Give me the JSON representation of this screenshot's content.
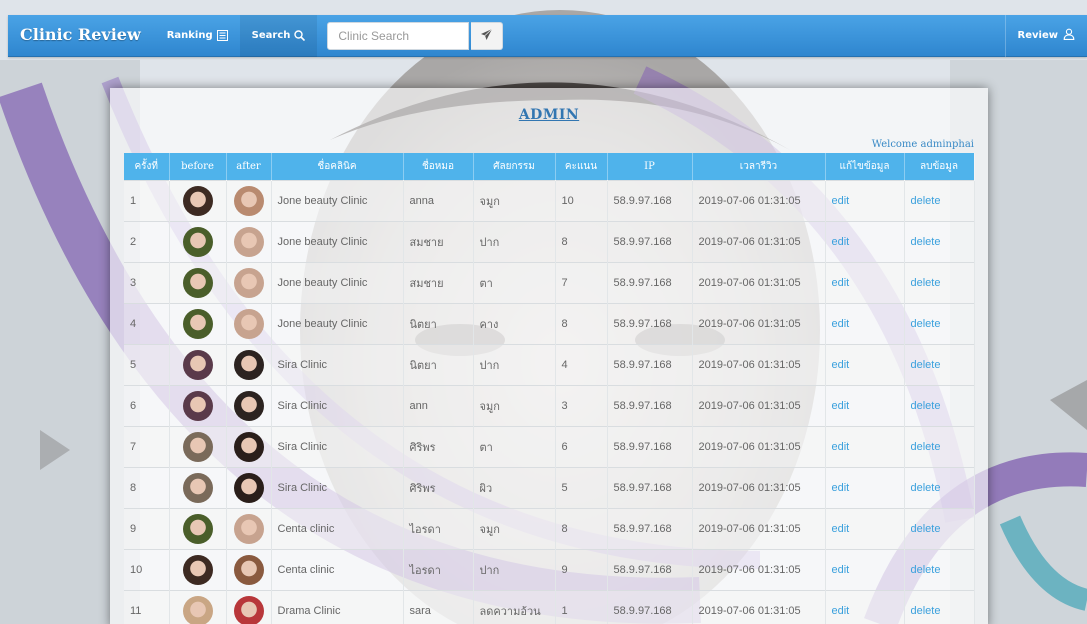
{
  "navbar": {
    "brand": "Clinic Review",
    "ranking_label": "Ranking",
    "search_label": "Search",
    "search_placeholder": "Clinic Search",
    "review_label": "Review"
  },
  "admin": {
    "title": "ADMIN",
    "welcome": "Welcome adminphai"
  },
  "table": {
    "headers": [
      "ครั้งที่",
      "before",
      "after",
      "ชื่อคลินิค",
      "ชื่อหมอ",
      "ศัลยกรรม",
      "คะแนน",
      "IP",
      "เวลารีวิว",
      "แก้ไขข้อมูล",
      "ลบข้อมูล"
    ],
    "rows": [
      {
        "no": "1",
        "clinic": "Jone beauty Clinic",
        "doctor": "anna",
        "surgery": "จมูก",
        "score": "10",
        "ip": "58.9.97.168",
        "time": "2019-07-06 01:31:05",
        "edit": "edit",
        "delete": "delete",
        "before_color": "#3d2a22",
        "after_color": "#b98a6f"
      },
      {
        "no": "2",
        "clinic": "Jone beauty Clinic",
        "doctor": "สมชาย",
        "surgery": "ปาก",
        "score": "8",
        "ip": "58.9.97.168",
        "time": "2019-07-06 01:31:05",
        "edit": "edit",
        "delete": "delete",
        "before_color": "#4a5e2a",
        "after_color": "#c7a38f"
      },
      {
        "no": "3",
        "clinic": "Jone beauty Clinic",
        "doctor": "สมชาย",
        "surgery": "ตา",
        "score": "7",
        "ip": "58.9.97.168",
        "time": "2019-07-06 01:31:05",
        "edit": "edit",
        "delete": "delete",
        "before_color": "#4a5e2a",
        "after_color": "#c7a38f"
      },
      {
        "no": "4",
        "clinic": "Jone beauty Clinic",
        "doctor": "นิตยา",
        "surgery": "คาง",
        "score": "8",
        "ip": "58.9.97.168",
        "time": "2019-07-06 01:31:05",
        "edit": "edit",
        "delete": "delete",
        "before_color": "#4a5e2a",
        "after_color": "#c7a38f"
      },
      {
        "no": "5",
        "clinic": "Sira Clinic",
        "doctor": "นิตยา",
        "surgery": "ปาก",
        "score": "4",
        "ip": "58.9.97.168",
        "time": "2019-07-06 01:31:05",
        "edit": "edit",
        "delete": "delete",
        "before_color": "#5a3a4a",
        "after_color": "#2c2320"
      },
      {
        "no": "6",
        "clinic": "Sira Clinic",
        "doctor": "ann",
        "surgery": "จมูก",
        "score": "3",
        "ip": "58.9.97.168",
        "time": "2019-07-06 01:31:05",
        "edit": "edit",
        "delete": "delete",
        "before_color": "#5a3a4a",
        "after_color": "#2c2320"
      },
      {
        "no": "7",
        "clinic": "Sira Clinic",
        "doctor": "ศิริพร",
        "surgery": "ตา",
        "score": "6",
        "ip": "58.9.97.168",
        "time": "2019-07-06 01:31:05",
        "edit": "edit",
        "delete": "delete",
        "before_color": "#7a6a5a",
        "after_color": "#2a1e1a"
      },
      {
        "no": "8",
        "clinic": "Sira Clinic",
        "doctor": "ศิริพร",
        "surgery": "ผิว",
        "score": "5",
        "ip": "58.9.97.168",
        "time": "2019-07-06 01:31:05",
        "edit": "edit",
        "delete": "delete",
        "before_color": "#7a6a5a",
        "after_color": "#2a1e1a"
      },
      {
        "no": "9",
        "clinic": "Centa clinic",
        "doctor": "ไอรดา",
        "surgery": "จมูก",
        "score": "8",
        "ip": "58.9.97.168",
        "time": "2019-07-06 01:31:05",
        "edit": "edit",
        "delete": "delete",
        "before_color": "#4a5e2a",
        "after_color": "#c7a38f"
      },
      {
        "no": "10",
        "clinic": "Centa clinic",
        "doctor": "ไอรดา",
        "surgery": "ปาก",
        "score": "9",
        "ip": "58.9.97.168",
        "time": "2019-07-06 01:31:05",
        "edit": "edit",
        "delete": "delete",
        "before_color": "#3d2a22",
        "after_color": "#8a5a3f"
      },
      {
        "no": "11",
        "clinic": "Drama Clinic",
        "doctor": "sara",
        "surgery": "ลดความอ้วน",
        "score": "1",
        "ip": "58.9.97.168",
        "time": "2019-07-06 01:31:05",
        "edit": "edit",
        "delete": "delete",
        "before_color": "#c9a684",
        "after_color": "#b8373a"
      }
    ]
  },
  "colors": {
    "navbar": "#3a93da",
    "header_row": "#4fb3eb",
    "link": "#3aa0dd",
    "title": "#3276b1"
  }
}
